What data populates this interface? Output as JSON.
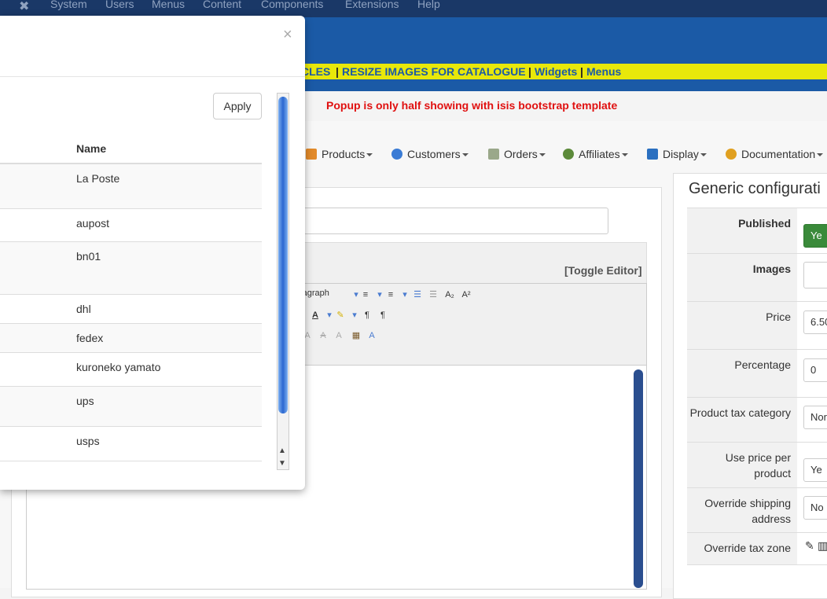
{
  "topbar": {
    "logo_glyph": "✖",
    "menu": [
      "System",
      "Users",
      "Menus",
      "Content",
      "Components",
      "Extensions",
      "Help"
    ]
  },
  "yellowbar": {
    "links": [
      "CLES",
      "RESIZE IMAGES FOR CATALOGUE",
      "Widgets",
      "Menus"
    ],
    "separator": "|"
  },
  "warning": "Popup is only half showing with isis bootstrap template",
  "toolbar_menu": [
    "Products",
    "Customers",
    "Orders",
    "Affiliates",
    "Display",
    "Documentation"
  ],
  "editor": {
    "toggle_label": "[Toggle Editor]",
    "paragraph_label": "ragraph"
  },
  "generic_config": {
    "title": "Generic configurati",
    "fields": [
      {
        "label": "Published",
        "value": "Ye",
        "style": "green"
      },
      {
        "label": "Images",
        "value": ""
      },
      {
        "label": "Price",
        "value": "6.50"
      },
      {
        "label": "Percentage",
        "value": "0"
      },
      {
        "label": "Product tax category",
        "value": "Nor"
      },
      {
        "label": "Use price per product",
        "value": "Ye"
      },
      {
        "label": "Override shipping address",
        "value": "No"
      },
      {
        "label": "Override tax zone",
        "value": ""
      }
    ]
  },
  "modal": {
    "close_glyph": "×",
    "apply_label": "Apply",
    "column_header": "Name",
    "rows": [
      "La Poste",
      "aupost",
      "bn01",
      "dhl",
      "fedex",
      "kuroneko yamato",
      "ups",
      "usps"
    ],
    "scroll_up_glyph": "▲",
    "scroll_down_glyph": "▼"
  },
  "colors": {
    "topbar": "#1a3867",
    "header": "#1b5aa6",
    "yellowbar": "#e8e80a",
    "warning": "#e01010",
    "published_green": "#3a8a3a"
  }
}
